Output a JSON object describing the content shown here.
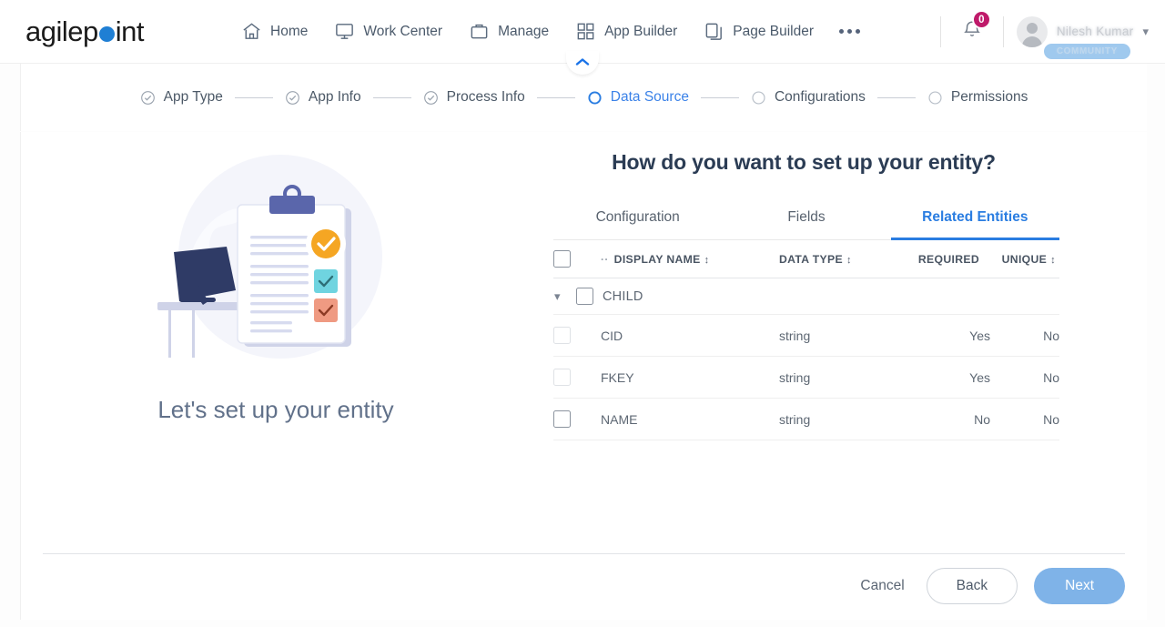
{
  "brand": {
    "name_part1": "agilep",
    "name_part2": "int",
    "dot_color": "#1f7fd4"
  },
  "header": {
    "nav": [
      {
        "label": "Home",
        "icon": "home-icon"
      },
      {
        "label": "Work Center",
        "icon": "monitor-icon"
      },
      {
        "label": "Manage",
        "icon": "briefcase-icon"
      },
      {
        "label": "App Builder",
        "icon": "grid-icon"
      },
      {
        "label": "Page Builder",
        "icon": "copy-icon"
      }
    ],
    "more_label": "more-options",
    "notification_count": "0",
    "notification_badge_color": "#bf1a6a",
    "user_name": "Nilesh Kumar",
    "user_badge": "COMMUNITY",
    "collapse_icon": "chevron-up-icon"
  },
  "stepper": {
    "steps": [
      {
        "label": "App Type",
        "state": "complete"
      },
      {
        "label": "App Info",
        "state": "complete"
      },
      {
        "label": "Process Info",
        "state": "complete"
      },
      {
        "label": "Data Source",
        "state": "active"
      },
      {
        "label": "Configurations",
        "state": "pending"
      },
      {
        "label": "Permissions",
        "state": "pending"
      }
    ],
    "active_color": "#3b82e8"
  },
  "left_panel": {
    "caption": "Let's set up your entity",
    "illustration": "clipboard-checklist-illustration"
  },
  "main": {
    "title": "How do you want to set up your entity?",
    "tabs": [
      {
        "label": "Configuration",
        "active": false
      },
      {
        "label": "Fields",
        "active": false
      },
      {
        "label": "Related Entities",
        "active": true
      }
    ],
    "table": {
      "prefix_marker": "..",
      "headers": [
        {
          "label": "DISPLAY NAME",
          "sortable": true
        },
        {
          "label": "DATA TYPE",
          "sortable": true
        },
        {
          "label": "REQUIRED",
          "sortable": false
        },
        {
          "label": "UNIQUE",
          "sortable": true
        }
      ],
      "groups": [
        {
          "name": "CHILD",
          "expanded": true,
          "rows": [
            {
              "display_name": "CID",
              "data_type": "string",
              "required": "Yes",
              "unique": "No",
              "checkbox_state": "disabled"
            },
            {
              "display_name": "FKEY",
              "data_type": "string",
              "required": "Yes",
              "unique": "No",
              "checkbox_state": "disabled"
            },
            {
              "display_name": "NAME",
              "data_type": "string",
              "required": "No",
              "unique": "No",
              "checkbox_state": "enabled"
            }
          ]
        }
      ]
    }
  },
  "footer": {
    "cancel_label": "Cancel",
    "back_label": "Back",
    "next_label": "Next",
    "next_color": "#7fb3e8"
  }
}
